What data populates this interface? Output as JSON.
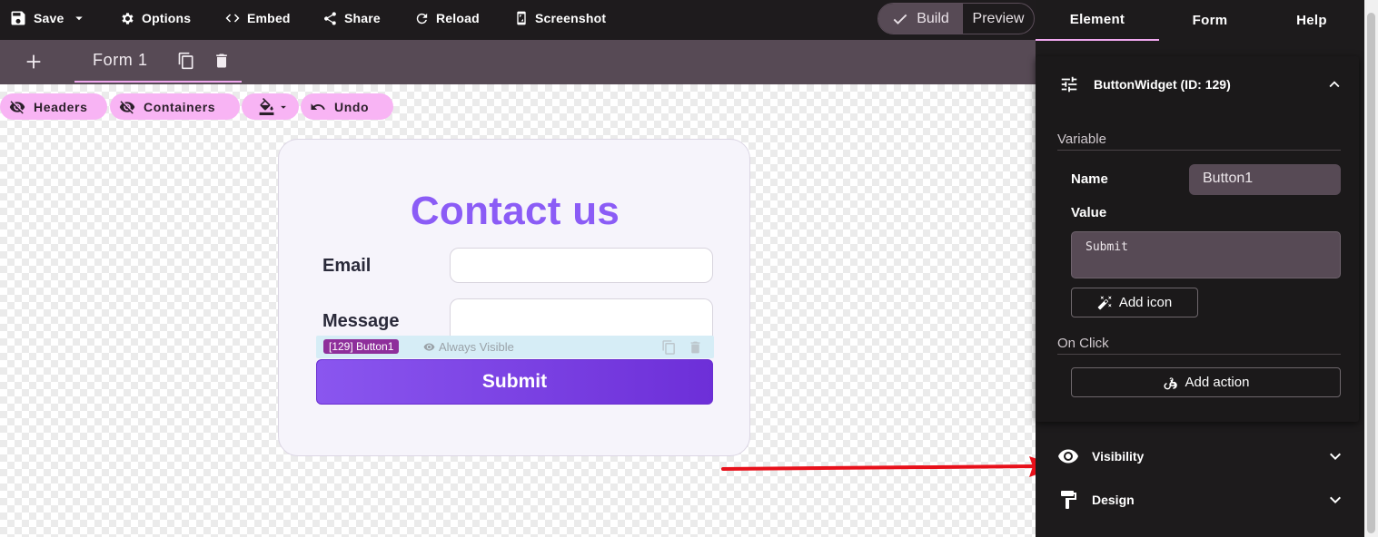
{
  "toolbar": {
    "save": "Save",
    "options": "Options",
    "embed": "Embed",
    "share": "Share",
    "reload": "Reload",
    "screenshot": "Screenshot",
    "mode": {
      "build": "Build",
      "preview": "Preview",
      "active": "build"
    }
  },
  "form_tabs": {
    "tabs": [
      {
        "label": "Form 1",
        "active": true
      }
    ]
  },
  "canvas_toolbar": {
    "headers": "Headers",
    "containers": "Containers",
    "undo": "Undo"
  },
  "form": {
    "title": "Contact us",
    "fields": [
      {
        "label": "Email",
        "value": ""
      },
      {
        "label": "Message",
        "value": ""
      }
    ],
    "selected_widget": {
      "tag": "[129] Button1",
      "visibility": "Always Visible"
    },
    "submit_label": "Submit"
  },
  "panel": {
    "tabs": [
      "Element",
      "Form",
      "Help"
    ],
    "active_tab": "Element",
    "section_title": "ButtonWidget (ID: 129)",
    "variable_heading": "Variable",
    "name_label": "Name",
    "name_value": "Button1",
    "value_label": "Value",
    "value_value": "Submit",
    "add_icon": "Add icon",
    "on_click_heading": "On Click",
    "add_action": "Add action",
    "visibility": "Visibility",
    "design": "Design"
  },
  "colors": {
    "accent_pink": "#f8b4f4",
    "title_purple": "#8b5cf6",
    "button_purple": "#6d2fd8",
    "toolbar_dark": "#1e1b1d",
    "tabs_mauve": "#574a55",
    "arrow_red": "#e8101a"
  },
  "icons": {
    "save": "floppy-disk-icon",
    "options": "gear-icon",
    "embed": "code-icon",
    "share": "share-icon",
    "reload": "reload-icon",
    "screenshot": "phone-screenshot-icon",
    "build": "check-icon",
    "form_copy": "copy-icon",
    "form_delete": "trash-icon",
    "headers": "eye-off-icon",
    "containers": "eye-off-icon",
    "paint": "paint-bucket-icon",
    "undo": "undo-icon",
    "section": "sliders-icon",
    "add_icon": "magic-wand-icon",
    "add_action": "webhook-icon",
    "visibility": "eye-icon",
    "design": "paint-roller-icon"
  }
}
